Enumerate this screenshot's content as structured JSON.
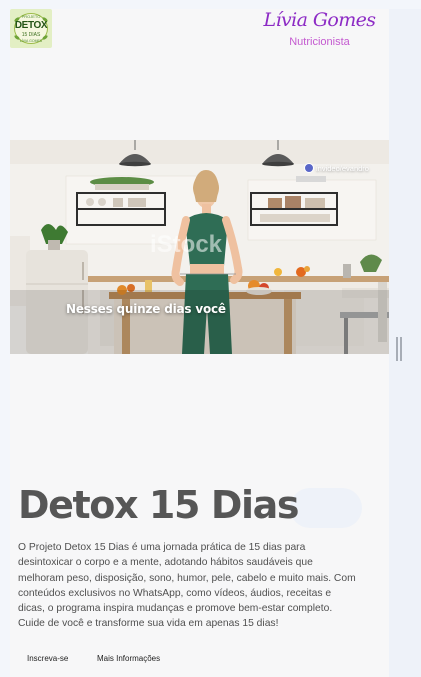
{
  "logo": {
    "top": "PROJETO",
    "main": "DETOX",
    "sub": "15 DIAS",
    "bottom": "LÍVIA GOMES"
  },
  "brand": {
    "name": "Lívia Gomes",
    "role": "Nutricionista",
    "accent": "#8d2bc5",
    "accent_light": "#c45ad0"
  },
  "hero": {
    "caption": "Nesses quinze dias você",
    "watermark": "iStock",
    "credit": "invideo/evandro"
  },
  "main": {
    "title": "Detox 15 Dias",
    "description": "O Projeto Detox 15 Dias é uma jornada prática de 15 dias para desintoxicar o corpo e a mente, adotando hábitos saudáveis que melhoram peso, disposição, sono, humor, pele, cabelo e muito mais. Com conteúdos exclusivos no WhatsApp, como vídeos, áudios, receitas e dicas, o programa inspira mudanças e promove bem-estar completo. Cuide de você e transforme sua vida em apenas 15 dias!"
  },
  "actions": {
    "signup_label": "Inscreva-se",
    "more_label": "Mais Informações"
  },
  "icons": {
    "badge": "invideo-logo-icon",
    "logo": "detox-leaf-badge-icon"
  }
}
